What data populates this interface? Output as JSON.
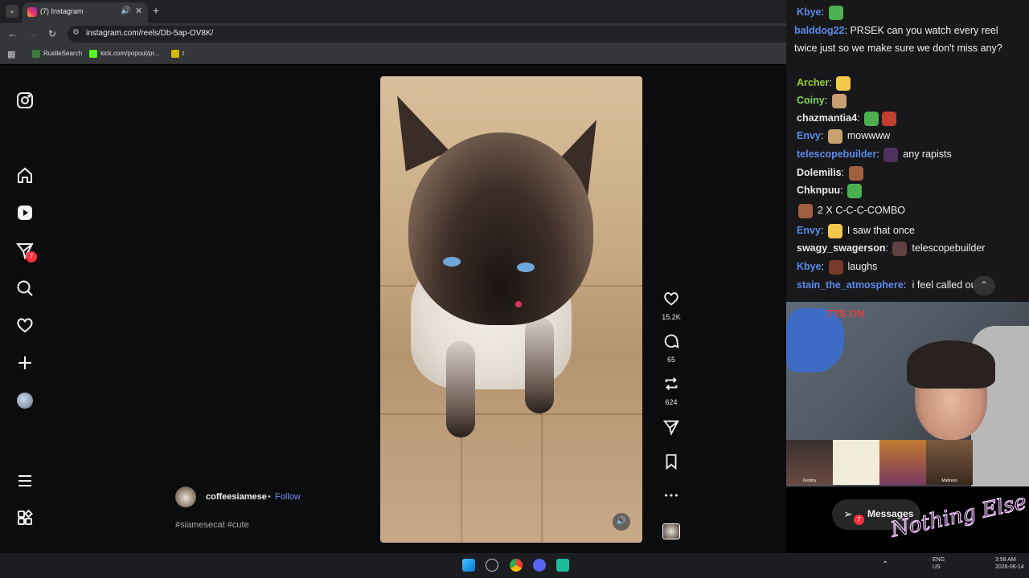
{
  "browser": {
    "tab_title": "(7) Instagram",
    "url": "instagram.com/reels/Db-5ap-OV8K/",
    "bookmarks": [
      {
        "label": "RustleSearch",
        "color": "#3b7a3b"
      },
      {
        "label": "kick.com/popout/pr...",
        "color": "#53fc18"
      },
      {
        "label": "t",
        "color": "#d6b800"
      }
    ]
  },
  "instagram": {
    "nav_badge": "7",
    "reel": {
      "author": "coffeesiamese",
      "separator": "•",
      "follow_label": "Follow",
      "tags": "#siamesecat #cute",
      "likes": "15.2K",
      "comments": "65",
      "reposts": "624"
    },
    "messages_label": "Messages",
    "messages_badge": "7"
  },
  "chat": {
    "messages": [
      {
        "user": "Kbye",
        "color": "#5b8ce8",
        "text": "",
        "emotes": [
          "#4caf50"
        ]
      },
      {
        "user": "Archer",
        "color": "#9acd32",
        "text": "",
        "emotes": [
          "#f2c94c"
        ]
      },
      {
        "user": "Coiny",
        "color": "#7cd85a",
        "text": "",
        "emotes": [
          "#c8a070"
        ]
      },
      {
        "user": "chazmantia4",
        "color": "#e8e8e8",
        "text": "",
        "emotes": [
          "#4caf50",
          "#c04030"
        ]
      },
      {
        "user": "Envy",
        "color": "#5b8ce8",
        "text": "mowwww",
        "emotes": [
          "#c8a070"
        ]
      },
      {
        "user": "telescopebuilder",
        "color": "#5b8ce8",
        "text": "any rapists",
        "emotes": [
          "#503060"
        ]
      },
      {
        "user": "Dolemilis",
        "color": "#e8e8e8",
        "text": "",
        "emotes": [
          "#a06040"
        ]
      },
      {
        "user": "Chknpuu",
        "color": "#e8e8e8",
        "text": "",
        "emotes": [
          "#4caf50"
        ]
      },
      {
        "user": "",
        "color": "#e8e8e8",
        "text": "2 X C-C-C-COMBO",
        "emotes": [
          "#a06040"
        ]
      },
      {
        "user": "Envy",
        "color": "#5b8ce8",
        "text": "I saw that once",
        "emotes": [
          "#f2c94c"
        ]
      },
      {
        "user": "swagy_swagerson",
        "color": "#e8e8e8",
        "text": "telescopebuilder",
        "emotes": [
          "#604040"
        ]
      },
      {
        "user": "Kbye",
        "color": "#5b8ce8",
        "text": "laughs",
        "emotes": [
          "#7a3a2a"
        ]
      },
      {
        "user": "stain_the_atmosphere",
        "color": "#5b8ce8",
        "text": "i feel called out",
        "emotes": []
      }
    ],
    "wrapped_user": "balddog22",
    "wrapped_text": "PRSEK can you watch every reel twice just so we make sure we don't miss any?"
  },
  "webcam": {
    "tts": "TTS ON",
    "thumbs": [
      "Destiny",
      "",
      "",
      "Mattress"
    ]
  },
  "taskbar": {
    "lang": "ENG",
    "region": "US",
    "time": "3:58 AM",
    "date": "2026-06-14"
  },
  "logo_text": "Nothing Else?"
}
